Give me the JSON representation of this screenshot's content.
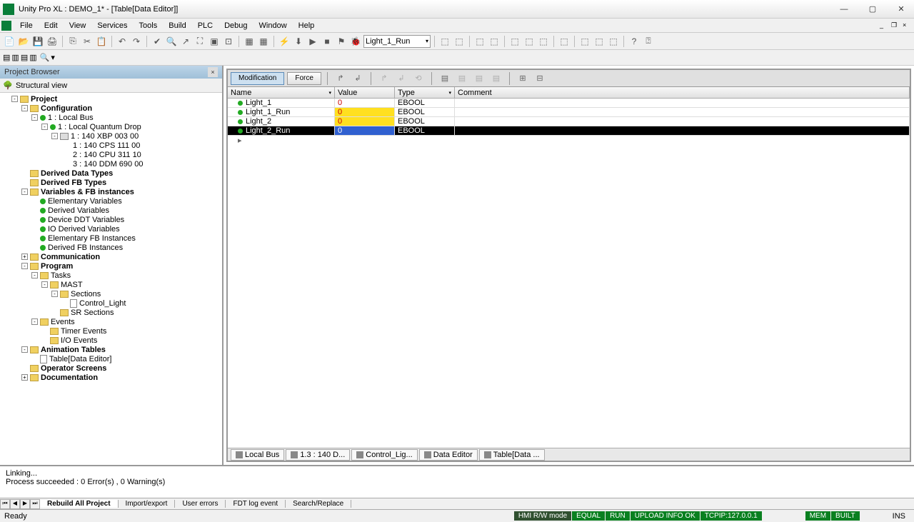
{
  "window": {
    "title": "Unity Pro XL : DEMO_1* - [Table[Data Editor]]"
  },
  "menu": [
    "File",
    "Edit",
    "View",
    "Services",
    "Tools",
    "Build",
    "PLC",
    "Debug",
    "Window",
    "Help"
  ],
  "toolbar_combo": "Light_1_Run",
  "project_browser": {
    "title": "Project Browser",
    "view_label": "Structural view"
  },
  "tree": {
    "root": "Project",
    "config": "Configuration",
    "bus": "1 : Local Bus",
    "drop": "1 : Local Quantum Drop",
    "rack": "1 : 140 XBP 003 00",
    "mod1": "1 : 140 CPS 111 00",
    "mod2": "2 : 140 CPU 311 10",
    "mod3": "3 : 140 DDM 690 00",
    "ddt": "Derived Data Types",
    "dfb": "Derived FB Types",
    "vars": "Variables & FB instances",
    "elem_vars": "Elementary Variables",
    "der_vars": "Derived Variables",
    "ddt_vars": "Device DDT Variables",
    "io_vars": "IO Derived Variables",
    "efb_inst": "Elementary FB Instances",
    "dfb_inst": "Derived FB Instances",
    "comm": "Communication",
    "program": "Program",
    "tasks": "Tasks",
    "mast": "MAST",
    "sections": "Sections",
    "ctrl_light": "Control_Light",
    "sr_sections": "SR Sections",
    "events": "Events",
    "timer_ev": "Timer Events",
    "io_ev": "I/O Events",
    "anim": "Animation Tables",
    "table_ed": "Table[Data Editor]",
    "op_screens": "Operator Screens",
    "docs": "Documentation"
  },
  "editor": {
    "btn_mod": "Modification",
    "btn_force": "Force",
    "headers": {
      "name": "Name",
      "value": "Value",
      "type": "Type",
      "comment": "Comment"
    },
    "rows": [
      {
        "name": "Light_1",
        "value": "0",
        "type": "EBOOL"
      },
      {
        "name": "Light_1_Run",
        "value": "0",
        "type": "EBOOL"
      },
      {
        "name": "Light_2",
        "value": "0",
        "type": "EBOOL"
      },
      {
        "name": "Light_2_Run",
        "value": "0",
        "type": "EBOOL"
      }
    ]
  },
  "bottom_tabs": [
    "Local Bus",
    "1.3 : 140 D...",
    "Control_Lig...",
    "Data Editor",
    "Table[Data ..."
  ],
  "output": {
    "line1": "Linking...",
    "line2": "Process succeeded : 0 Error(s) , 0 Warning(s)"
  },
  "out_tabs": [
    "Rebuild All Project",
    "Import/export",
    "User errors",
    "FDT log event",
    "Search/Replace"
  ],
  "status": {
    "ready": "Ready",
    "hmi": "HMI R/W mode",
    "equal": "EQUAL",
    "run": "RUN",
    "upload": "UPLOAD INFO OK",
    "tcp": "TCPIP:127.0.0.1",
    "mem": "MEM",
    "built": "BUILT",
    "ins": "INS"
  }
}
